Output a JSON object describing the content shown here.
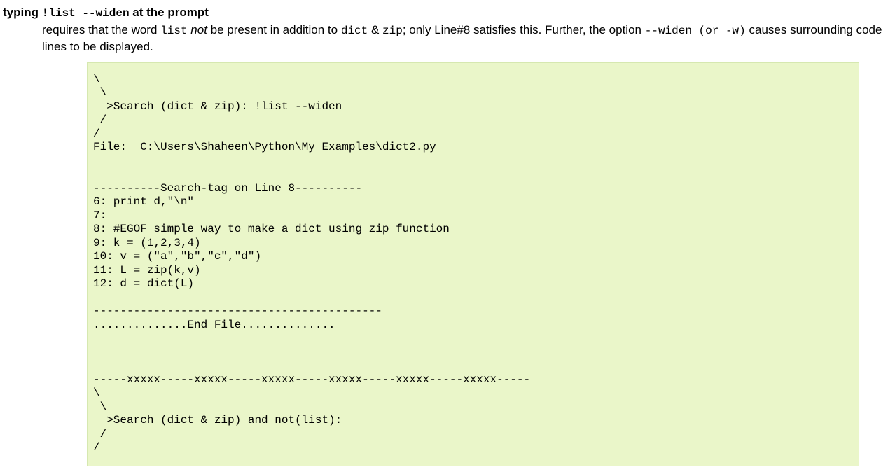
{
  "heading": {
    "prefix": "typing ",
    "cmd": "!list --widen",
    "suffix": " at the prompt"
  },
  "desc": {
    "t1": "requires that the word ",
    "code1": "list",
    "italic": " not",
    "t2": " be present in addition to ",
    "code2": "dict",
    "amp": " & ",
    "code3": "zip",
    "t3": "; only Line#8 satisfies this. Further, the option ",
    "code4": "--widen (or -w)",
    "t4": " causes surrounding code lines to be displayed."
  },
  "code": "\\\n \\\n  >Search (dict & zip): !list --widen\n /\n/\nFile:  C:\\Users\\Shaheen\\Python\\My Examples\\dict2.py\n\n\n----------Search-tag on Line 8----------\n6: print d,\"\\n\"\n7:\n8: #EGOF simple way to make a dict using zip function\n9: k = (1,2,3,4)\n10: v = (\"a\",\"b\",\"c\",\"d\")\n11: L = zip(k,v)\n12: d = dict(L)\n\n-------------------------------------------\n..............End File..............\n\n\n\n-----xxxxx-----xxxxx-----xxxxx-----xxxxx-----xxxxx-----xxxxx-----\n\\\n \\\n  >Search (dict & zip) and not(list):\n /\n/"
}
